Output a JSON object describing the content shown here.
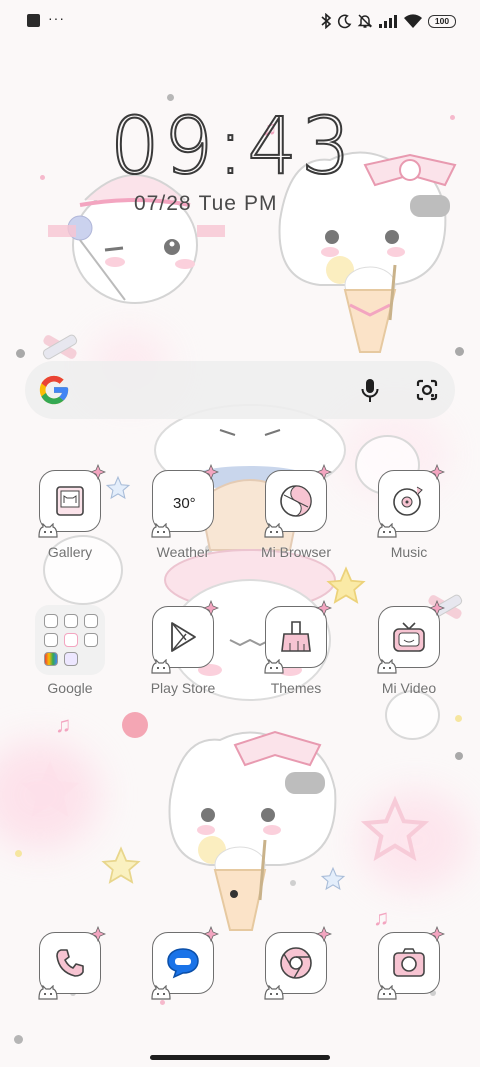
{
  "status_bar": {
    "battery": "100",
    "left_icons": [
      "app-notification-icon",
      "more-dots-icon"
    ],
    "right_icons": [
      "bluetooth-icon",
      "moon-icon",
      "bell-off-icon",
      "signal-icon",
      "wifi-icon",
      "battery-icon"
    ]
  },
  "clock": {
    "time_h": "09",
    "time_sep": ":",
    "time_m": "43",
    "date": "07/28",
    "weekday": "Tue",
    "period": "PM"
  },
  "search": {
    "placeholder": "",
    "icons": [
      "google-icon",
      "mic-icon",
      "lens-icon"
    ]
  },
  "apps": {
    "gallery": "Gallery",
    "weather": "Weather",
    "weather_temp": "30°",
    "browser": "Mi Browser",
    "music": "Music",
    "google": "Google",
    "play_store": "Play Store",
    "themes": "Themes",
    "video": "Mi Video"
  },
  "dock": [
    "phone-icon",
    "messages-icon",
    "chrome-icon",
    "camera-icon"
  ],
  "colors": {
    "accent_pink": "#f3a5c0",
    "icon_border": "#6f6f6f",
    "google_blue": "#4285F4",
    "google_red": "#EA4335",
    "google_yellow": "#FBBC05",
    "google_green": "#34A853"
  }
}
